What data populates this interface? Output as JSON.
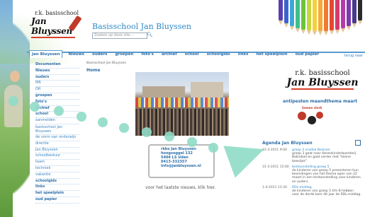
{
  "header": {
    "logo_small": "r.k. basisschool",
    "logo_big": "Jan Bluyssen",
    "site_title": "Basisschool Jan Bluyssen",
    "search_placeholder": "Zoeken op deze site..."
  },
  "nav": {
    "items": [
      "Jan Bluyssen",
      "Nieuws",
      "ouders",
      "groepen",
      "foto's",
      "archief",
      "school",
      "schoolgids",
      "links",
      "het speelplein",
      "oud papier"
    ]
  },
  "top_link": "terug naar",
  "breadcrumb": "Basisschool Jan Bluyssen",
  "page_heading": "Home",
  "sidebar": {
    "items": [
      {
        "label": "Documenten",
        "bold": true
      },
      {
        "label": "Nieuws",
        "bold": true
      },
      {
        "label": "ouders",
        "bold": true
      },
      {
        "label": "MR",
        "bold": false
      },
      {
        "label": "OR",
        "bold": false
      },
      {
        "label": "groepen",
        "bold": true
      },
      {
        "label": "foto's",
        "bold": true
      },
      {
        "label": "archief",
        "bold": true
      },
      {
        "label": "school",
        "bold": true
      },
      {
        "label": "aanmelden",
        "bold": false
      },
      {
        "label": "basisschool Jan Bluyssen",
        "bold": false
      },
      {
        "label": "de vorm van onderwijs",
        "bold": false
      },
      {
        "label": "directie",
        "bold": false
      },
      {
        "label": "Jan Bluyssen",
        "bold": false
      },
      {
        "label": "schoolbestuur",
        "bold": false
      },
      {
        "label": "team",
        "bold": false
      },
      {
        "label": "techniek",
        "bold": false
      },
      {
        "label": "vakantie",
        "bold": false
      },
      {
        "label": "schoolgids",
        "bold": true
      },
      {
        "label": "links",
        "bold": true
      },
      {
        "label": "het speelplein",
        "bold": true
      },
      {
        "label": "oud papier",
        "bold": true
      }
    ]
  },
  "address": {
    "name": "rkbs Jan Bluyssen",
    "street": "hoogsoggel 132",
    "city": "5404 LS Uden",
    "phone": "0413-332357",
    "email": "info@janbluyssen.nl"
  },
  "news_link": "voor het laatste nieuws, klik hier.",
  "right_logo": {
    "small": "r.k. basisschool",
    "big": "Jan Bluyssen"
  },
  "antipesten": "antipesten maandthema maart",
  "bug_label": "Samen sterk",
  "agenda": {
    "title": "Agenda Jan Bluyssen",
    "items": [
      {
        "date": "31-3-2011 9:00",
        "heading": "groep 3 eruitke Bezinen",
        "text": "groep 3 gaat naar dierenkinderboerderij Balindoel en gaat verder met \"kleine beestjes\""
      },
      {
        "date": "31-3-2011 15:00",
        "heading": "tentoonstelling groep 5",
        "text": "de kinderen van groep 5 presenteren hun bevindingen van het thema open van 22 maart in een tentoonstelling voor kinderen en ouders."
      },
      {
        "date": "1-4-2011 13:30",
        "heading": "RDL-middag",
        "text": "de kinderen van groep 5 t/m 8 hebben voor de derde keer dit jaar de RDL-middag."
      }
    ]
  },
  "colors": {
    "accent": "#2d6ea8",
    "link": "#3a84c4",
    "mint": "#8fdcc6",
    "brand_red": "#d9412b"
  }
}
